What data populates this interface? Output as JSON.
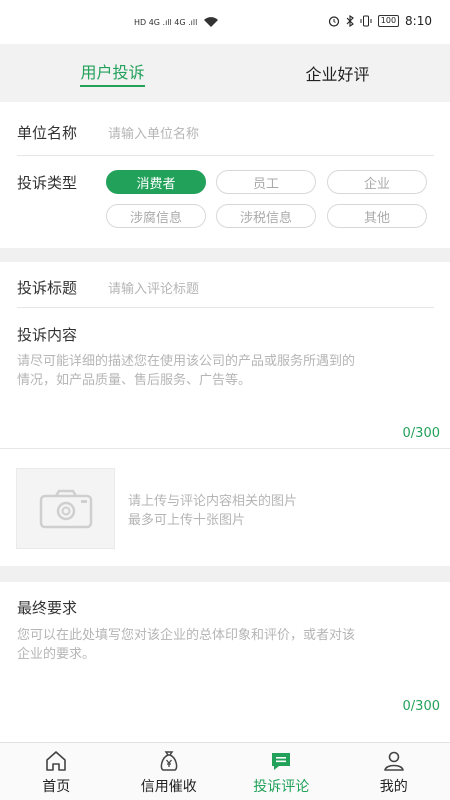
{
  "status_bar": {
    "signal_left": "HD 4G .ıll 4G .ıll",
    "battery": "100",
    "time": "8:10"
  },
  "tabs": [
    {
      "label": "用户投诉",
      "active": true
    },
    {
      "label": "企业好评",
      "active": false
    }
  ],
  "form": {
    "company": {
      "label": "单位名称",
      "placeholder": "请输入单位名称"
    },
    "type": {
      "label": "投诉类型",
      "options": [
        "消费者",
        "员工",
        "企业",
        "涉腐信息",
        "涉税信息",
        "其他"
      ],
      "selected": "消费者"
    },
    "title": {
      "label": "投诉标题",
      "placeholder": "请输入评论标题"
    },
    "content": {
      "label": "投诉内容",
      "placeholder_line1": "请尽可能详细的描述您在使用该公司的产品或服务所遇到的",
      "placeholder_line2": "情况，如产品质量、售后服务、广告等。",
      "counter": "0/300"
    },
    "upload": {
      "tip_line1": "请上传与评论内容相关的图片",
      "tip_line2": "最多可上传十张图片"
    },
    "final": {
      "label": "最终要求",
      "placeholder_line1": "您可以在此处填写您对该企业的总体印象和评价，或者对该",
      "placeholder_line2": "企业的要求。",
      "counter": "0/300"
    }
  },
  "bottom_nav": [
    {
      "label": "首页",
      "icon": "home-icon",
      "active": false
    },
    {
      "label": "信用催收",
      "icon": "money-bag-icon",
      "active": false
    },
    {
      "label": "投诉评论",
      "icon": "comment-icon",
      "active": true
    },
    {
      "label": "我的",
      "icon": "person-icon",
      "active": false
    }
  ],
  "colors": {
    "accent": "#22a15a",
    "placeholder": "#b5b5b5",
    "divider": "#f0f0f0"
  }
}
